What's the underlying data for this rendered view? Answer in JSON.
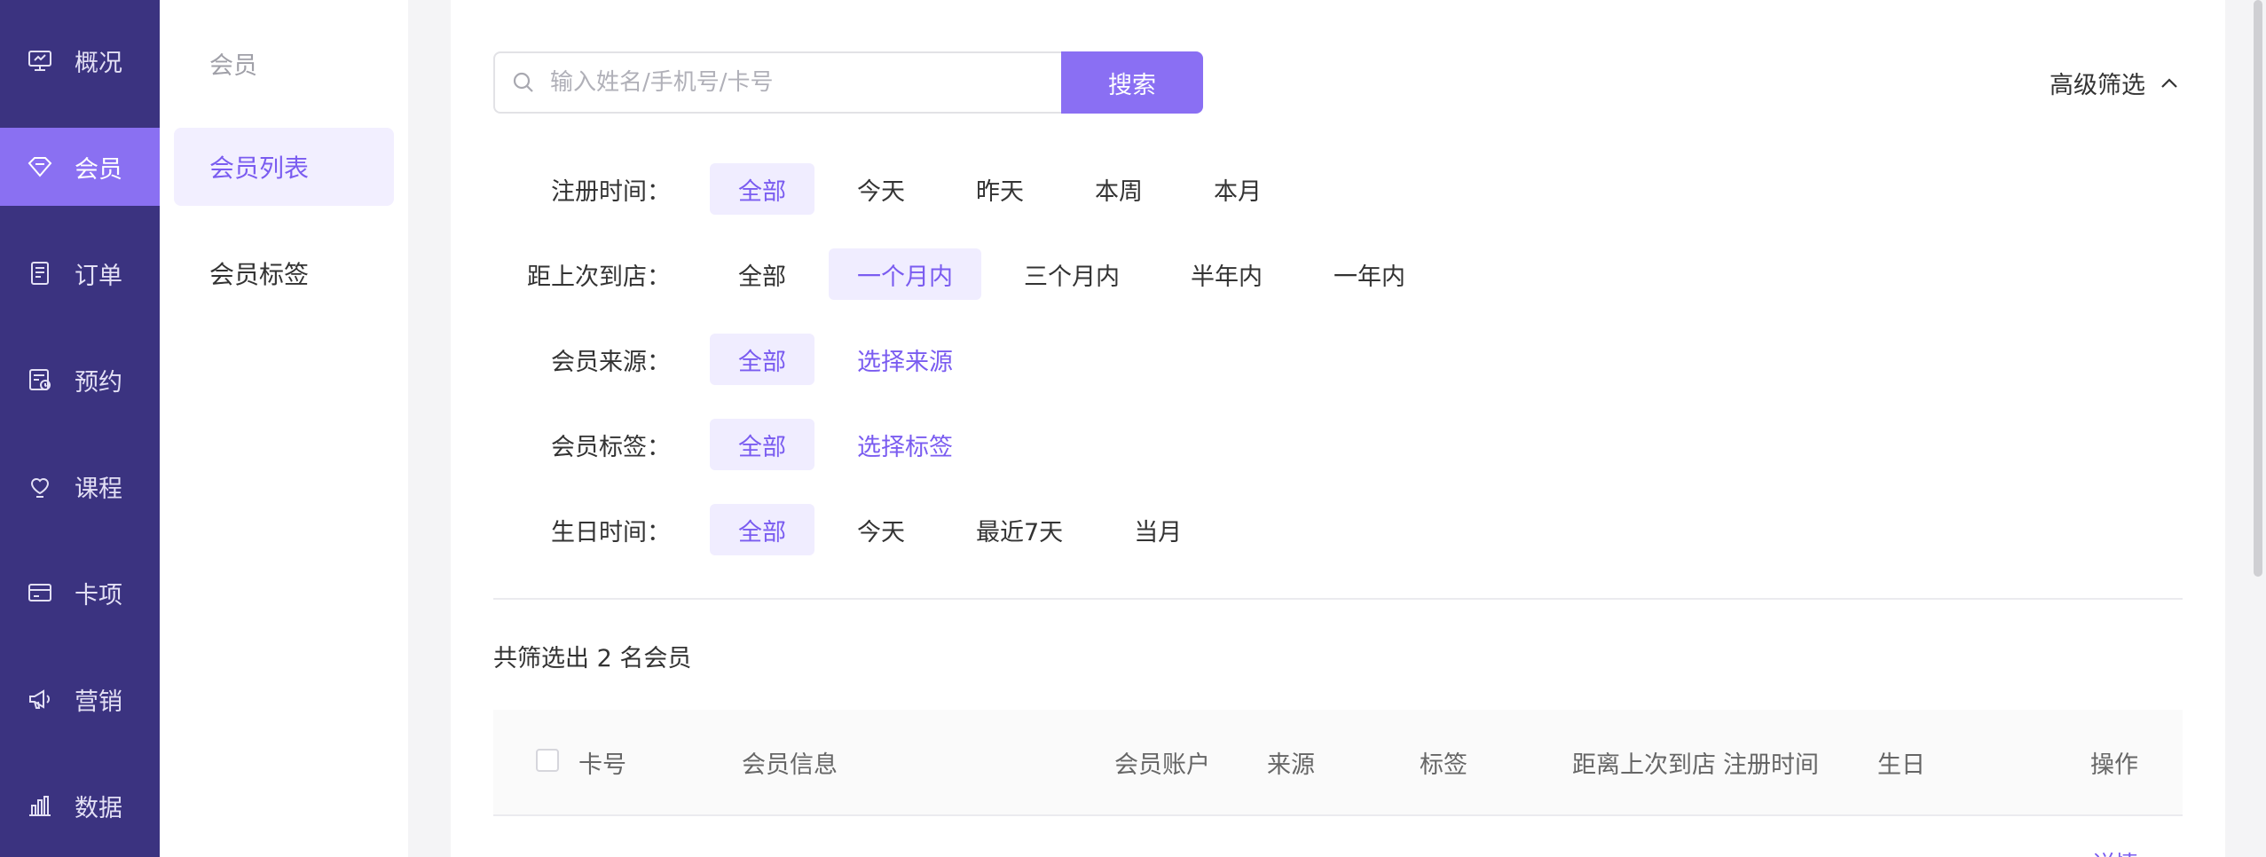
{
  "nav": {
    "items": [
      {
        "label": "概况",
        "icon": "monitor-icon"
      },
      {
        "label": "会员",
        "icon": "diamond-icon"
      },
      {
        "label": "订单",
        "icon": "receipt-icon"
      },
      {
        "label": "预约",
        "icon": "calendar-clock-icon"
      },
      {
        "label": "课程",
        "icon": "heart-hand-icon"
      },
      {
        "label": "卡项",
        "icon": "card-icon"
      },
      {
        "label": "营销",
        "icon": "megaphone-icon"
      },
      {
        "label": "数据",
        "icon": "bar-chart-icon"
      }
    ],
    "active_index": 1
  },
  "subnav": {
    "group_title": "会员",
    "items": [
      {
        "label": "会员列表"
      },
      {
        "label": "会员标签"
      }
    ],
    "active_index": 0
  },
  "search": {
    "placeholder": "输入姓名/手机号/卡号",
    "button_label": "搜索",
    "advanced_label": "高级筛选"
  },
  "filters": [
    {
      "label": "注册时间：",
      "options": [
        "全部",
        "今天",
        "昨天",
        "本周",
        "本月"
      ],
      "active": 0
    },
    {
      "label": "距上次到店：",
      "options": [
        "全部",
        "一个月内",
        "三个月内",
        "半年内",
        "一年内"
      ],
      "active": 1
    },
    {
      "label": "会员来源：",
      "options": [
        "全部",
        "选择来源"
      ],
      "active": 0
    },
    {
      "label": "会员标签：",
      "options": [
        "全部",
        "选择标签"
      ],
      "active": 0
    },
    {
      "label": "生日时间：",
      "options": [
        "全部",
        "今天",
        "最近7天",
        "当月"
      ],
      "active": 0
    }
  ],
  "result_summary": "共筛选出 2 名会员",
  "table": {
    "columns": [
      "卡号",
      "会员信息",
      "会员账户",
      "来源",
      "标签",
      "距离上次到店",
      "注册时间",
      "生日",
      "操作"
    ],
    "row_action_peek": "详情"
  },
  "colors": {
    "sidebar_bg": "#3b3380",
    "accent": "#8a70f2",
    "accent_text": "#7a5cf0",
    "active_bg": "#f0edff"
  }
}
